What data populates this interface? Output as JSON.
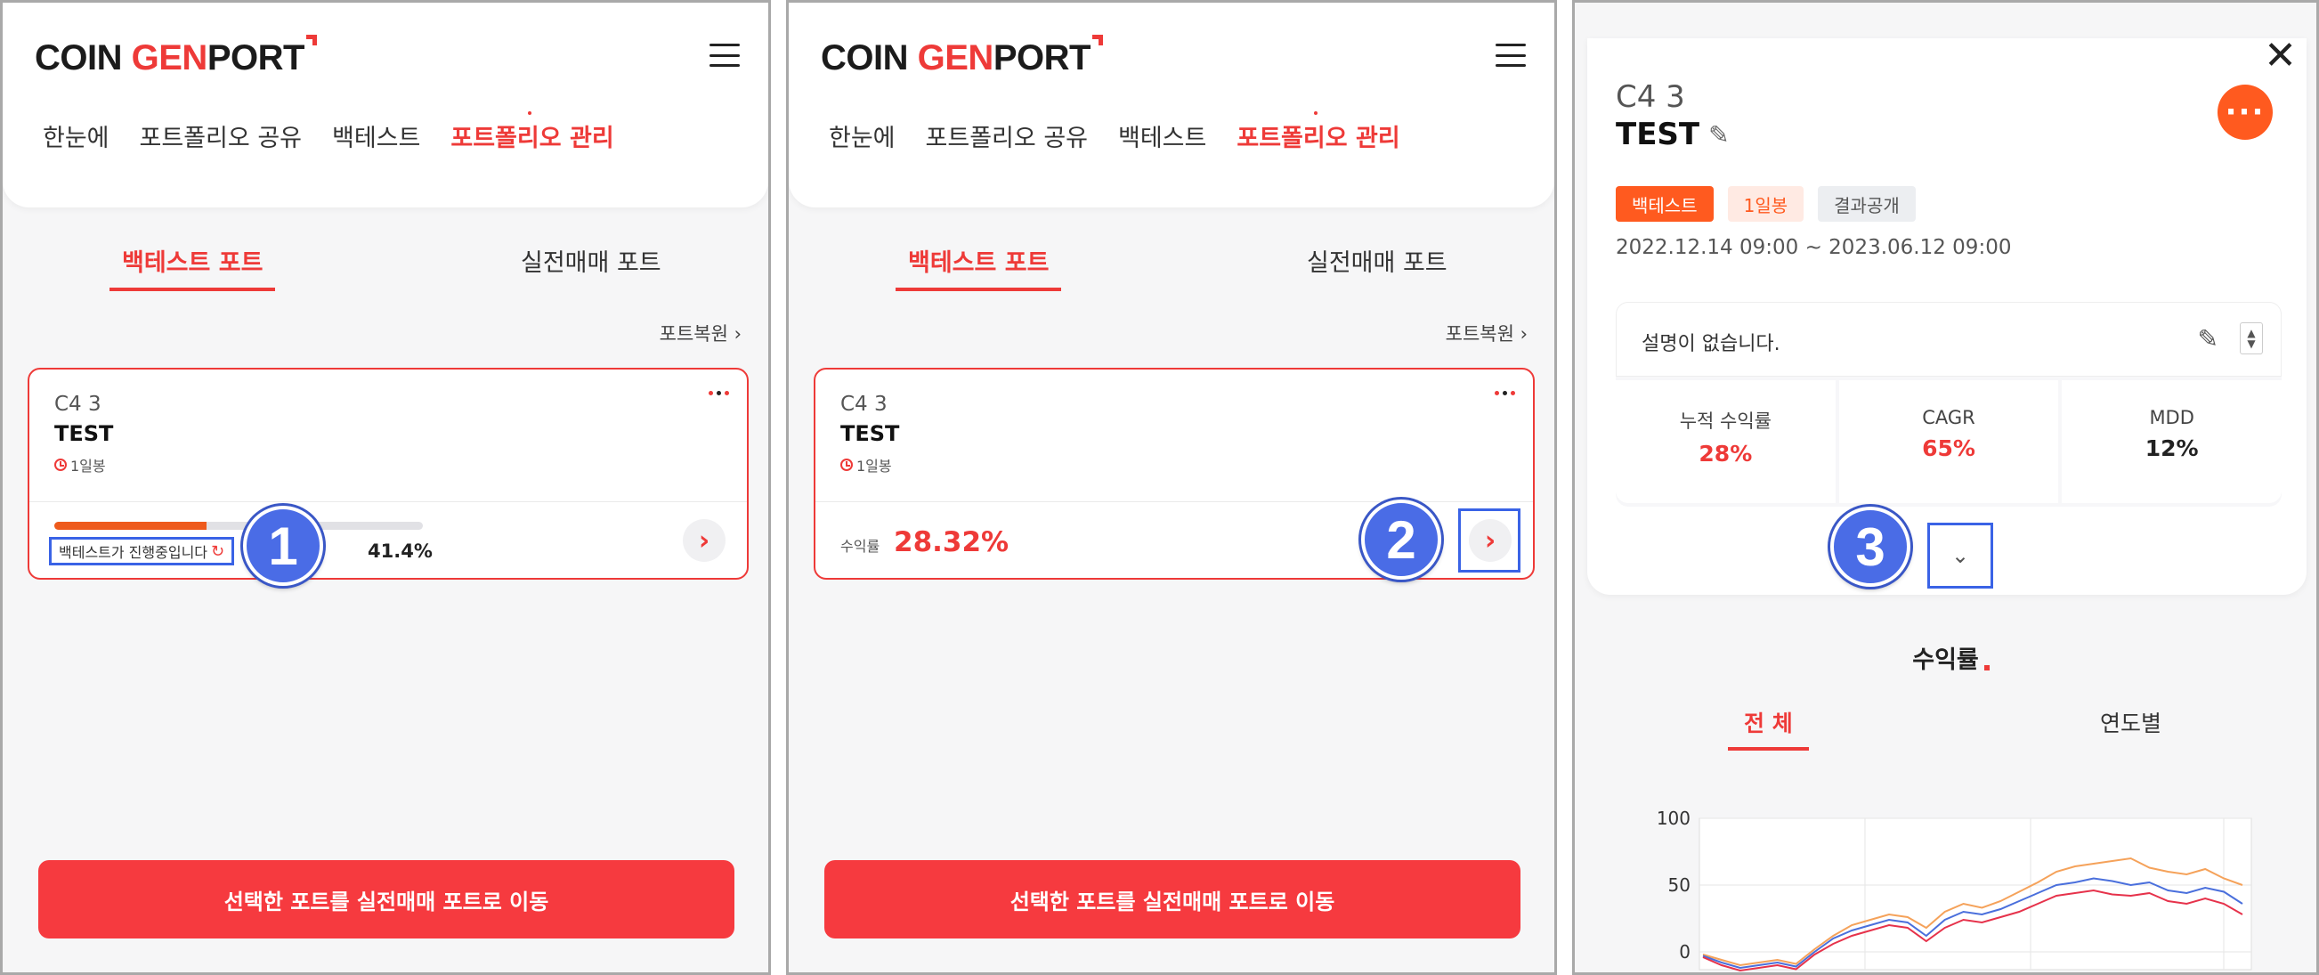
{
  "header": {
    "logo_coin": "COIN ",
    "logo_gen": "GEN",
    "logo_port": "PORT",
    "nav": [
      "한눈에",
      "포트폴리오 공유",
      "백테스트",
      "포트폴리오 관리"
    ]
  },
  "tabs": {
    "backtest": "백테스트 포트",
    "live": "실전매매 포트"
  },
  "restore_label": "포트복원",
  "port_card": {
    "name": "C4      3",
    "title": "TEST",
    "interval": "1일봉",
    "progress_status": "백테스트가 진행중입니다",
    "progress_percent": "41.4%",
    "progress_fraction": 0.414,
    "return_label": "수익률",
    "return_value": "28.32%"
  },
  "bottom_button": "선택한 포트를 실전매매 포트로 이동",
  "steps": [
    "1",
    "2",
    "3"
  ],
  "detail": {
    "name": "C4      3",
    "title": "TEST",
    "tags": [
      "백테스트",
      "1일봉",
      "결과공개"
    ],
    "period": "2022.12.14 09:00 ~ 2023.06.12 09:00",
    "description": "설명이 없습니다.",
    "stats": [
      {
        "label": "누적 수익률",
        "value": "28%"
      },
      {
        "label": "CAGR",
        "value": "65%"
      },
      {
        "label": "MDD",
        "value": "12%"
      }
    ],
    "section_title": "수익률",
    "period_tabs": [
      "전 체",
      "연도별"
    ]
  },
  "colors": {
    "accent": "#ee3a38",
    "orange": "#ff5a1f",
    "highlight": "#3a63e6"
  },
  "chart_data": {
    "type": "line",
    "ylim": [
      0,
      100
    ],
    "yticks": [
      "0",
      "50",
      "100"
    ],
    "series": [
      {
        "color": "#f5a25a",
        "values": [
          -2,
          -6,
          -10,
          -8,
          -6,
          -9,
          2,
          12,
          20,
          24,
          28,
          26,
          18,
          30,
          36,
          33,
          38,
          45,
          52,
          60,
          64,
          66,
          68,
          70,
          63,
          60,
          58,
          62,
          55,
          50
        ]
      },
      {
        "color": "#4a6fdc",
        "values": [
          -3,
          -8,
          -12,
          -10,
          -8,
          -11,
          0,
          10,
          16,
          20,
          24,
          22,
          12,
          24,
          30,
          28,
          32,
          38,
          44,
          50,
          52,
          55,
          53,
          50,
          52,
          46,
          44,
          48,
          45,
          36
        ]
      },
      {
        "color": "#e6324b",
        "values": [
          -4,
          -10,
          -14,
          -12,
          -10,
          -13,
          -2,
          6,
          12,
          16,
          20,
          18,
          8,
          18,
          24,
          22,
          26,
          30,
          36,
          42,
          44,
          46,
          43,
          42,
          44,
          38,
          36,
          40,
          36,
          28
        ]
      }
    ]
  }
}
